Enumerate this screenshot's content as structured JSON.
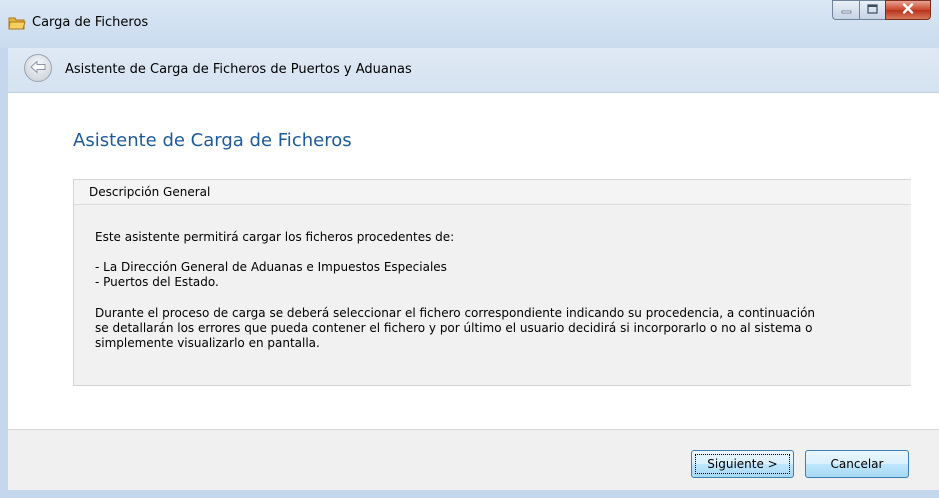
{
  "window": {
    "title": "Carga de Ficheros"
  },
  "header": {
    "text": "Asistente de Carga de Ficheros de Puertos y Aduanas"
  },
  "page": {
    "title": "Asistente de Carga de Ficheros"
  },
  "group": {
    "header": "Descripción General",
    "intro": "Este asistente permitirá cargar los ficheros procedentes de:",
    "items": [
      "- La Dirección General de Aduanas e Impuestos Especiales",
      "- Puertos del Estado."
    ],
    "paragraph_lines": [
      "Durante el proceso de carga se deberá seleccionar el fichero correspondiente indicando su procedencia, a continuación",
      "se detallarán los errores que pueda contener el fichero y por último el usuario decidirá si incorporarlo o no al sistema o",
      "simplemente visualizarlo en pantalla."
    ]
  },
  "footer": {
    "next_label": "Siguiente >",
    "cancel_label": "Cancelar"
  },
  "icons": {
    "app": "folder-icon",
    "back": "back-arrow-icon",
    "minimize": "minimize-icon",
    "maximize": "maximize-icon",
    "close": "close-icon"
  },
  "colors": {
    "title_blue": "#1e5a9a",
    "frame": "#c4d7ec",
    "close_red": "#c9442a"
  }
}
